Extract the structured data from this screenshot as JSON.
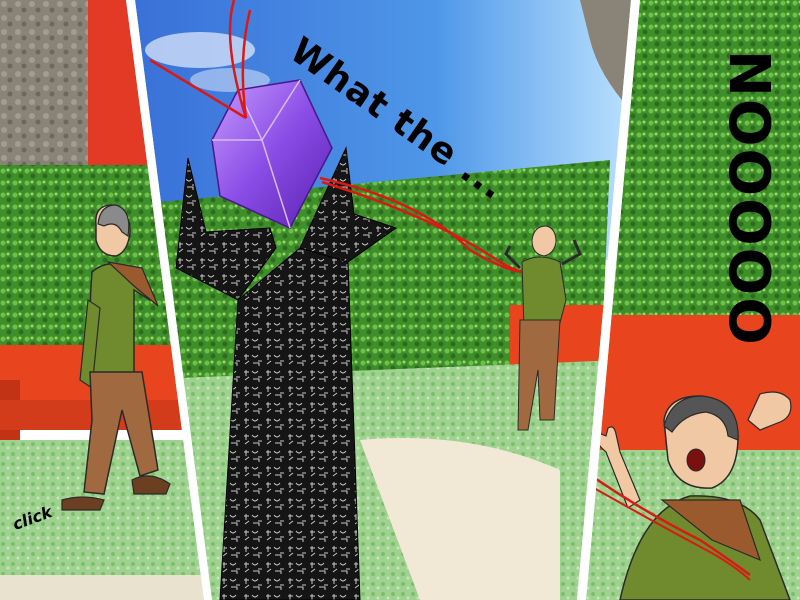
{
  "comic": {
    "panels": [
      {
        "caption": "click"
      },
      {
        "caption": "What the ..."
      },
      {
        "caption": "NOOOOO"
      }
    ]
  }
}
